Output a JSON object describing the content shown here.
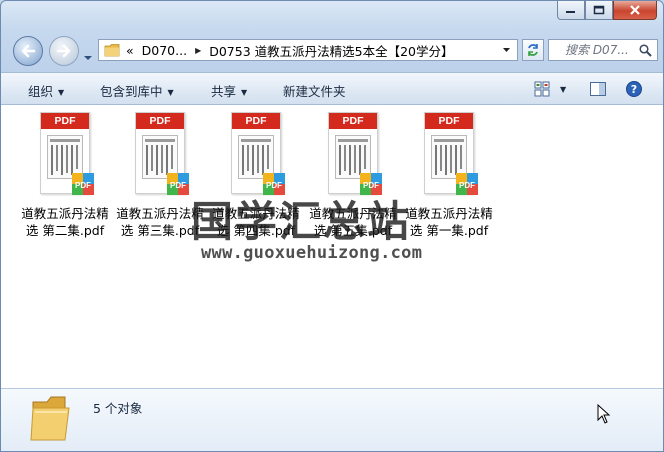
{
  "window": {
    "caption": {
      "minimize": "minimize",
      "maximize": "maximize",
      "close": "close"
    }
  },
  "address": {
    "prefix": "«",
    "crumbs": [
      "D070...",
      "D0753 道教五派丹法精选5本全【20学分】"
    ]
  },
  "search": {
    "placeholder": "搜索 D07..."
  },
  "toolbar": {
    "organize": "组织",
    "include_library": "包含到库中",
    "share": "共享",
    "new_folder": "新建文件夹"
  },
  "files": [
    {
      "name": "道教五派丹法精选 第二集.pdf",
      "badge": "PDF"
    },
    {
      "name": "道教五派丹法精选 第三集.pdf",
      "badge": "PDF"
    },
    {
      "name": "道教五派丹法精选 第四集.pdf",
      "badge": "PDF"
    },
    {
      "name": "道教五派丹法精选 第五集.pdf",
      "badge": "PDF"
    },
    {
      "name": "道教五派丹法精选 第一集.pdf",
      "badge": "PDF"
    }
  ],
  "watermark": {
    "title": "国学汇总站",
    "url": "www.guoxuehuizong.com"
  },
  "details": {
    "count": "5 个对象"
  },
  "colors": {
    "pdf_red": "#d42a1e",
    "window_blue": "#c5d8ee",
    "close_red": "#c9452e"
  }
}
